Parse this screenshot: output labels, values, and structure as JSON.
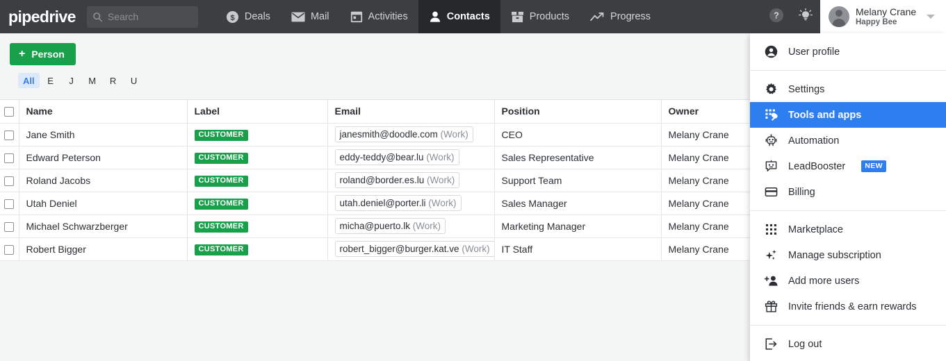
{
  "topnav": {
    "brand": "pipedrive",
    "search": {
      "placeholder": "Search",
      "value": "",
      "icon": "search-icon"
    },
    "items": [
      {
        "label": "Deals",
        "icon": "dollar-circle-icon",
        "active": false
      },
      {
        "label": "Mail",
        "icon": "envelope-icon",
        "active": false
      },
      {
        "label": "Activities",
        "icon": "calendar-icon",
        "active": false
      },
      {
        "label": "Contacts",
        "icon": "person-icon",
        "active": true
      },
      {
        "label": "Products",
        "icon": "box-icon",
        "active": false
      },
      {
        "label": "Progress",
        "icon": "trend-up-icon",
        "active": false
      }
    ],
    "help_icon": "question-circle-icon",
    "tips_icon": "lightbulb-icon",
    "user": {
      "name": "Melany Crane",
      "company": "Happy Bee",
      "avatar": "avatar",
      "caret": "chevron-down-icon"
    }
  },
  "toolbar": {
    "add_person_label": "Person",
    "add_person_plus": "+",
    "alpha_tabs": [
      {
        "label": "All",
        "active": true
      },
      {
        "label": "E",
        "active": false
      },
      {
        "label": "J",
        "active": false
      },
      {
        "label": "M",
        "active": false
      },
      {
        "label": "R",
        "active": false
      },
      {
        "label": "U",
        "active": false
      }
    ]
  },
  "table": {
    "columns": [
      "Name",
      "Label",
      "Email",
      "Position",
      "Owner"
    ],
    "rows": [
      {
        "name": "Jane Smith",
        "label": "CUSTOMER",
        "email": "janesmith@doodle.com",
        "email_type": "(Work)",
        "position": "CEO",
        "owner": "Melany Crane"
      },
      {
        "name": "Edward Peterson",
        "label": "CUSTOMER",
        "email": "eddy-teddy@bear.lu",
        "email_type": "(Work)",
        "position": "Sales Representative",
        "owner": "Melany Crane"
      },
      {
        "name": "Roland Jacobs",
        "label": "CUSTOMER",
        "email": "roland@border.es.lu",
        "email_type": "(Work)",
        "position": "Support Team",
        "owner": "Melany Crane"
      },
      {
        "name": "Utah Deniel",
        "label": "CUSTOMER",
        "email": "utah.deniel@porter.li",
        "email_type": "(Work)",
        "position": "Sales Manager",
        "owner": "Melany Crane"
      },
      {
        "name": "Michael Schwarzberger",
        "label": "CUSTOMER",
        "email": "micha@puerto.lk",
        "email_type": "(Work)",
        "position": "Marketing Manager",
        "owner": "Melany Crane"
      },
      {
        "name": "Robert Bigger",
        "label": "CUSTOMER",
        "email": "robert_bigger@burger.kat.ve",
        "email_type": "(Work)",
        "position": "IT Staff",
        "owner": "Melany Crane"
      }
    ]
  },
  "dropdown": {
    "groups": [
      [
        {
          "label": "User profile",
          "icon": "user-circle-icon",
          "selected": false,
          "badge": ""
        }
      ],
      [
        {
          "label": "Settings",
          "icon": "gear-icon",
          "selected": false,
          "badge": ""
        },
        {
          "label": "Tools and apps",
          "icon": "tools-apps-icon",
          "selected": true,
          "badge": ""
        },
        {
          "label": "Automation",
          "icon": "robot-icon",
          "selected": false,
          "badge": ""
        },
        {
          "label": "LeadBooster",
          "icon": "chatbot-icon",
          "selected": false,
          "badge": "NEW"
        },
        {
          "label": "Billing",
          "icon": "credit-card-icon",
          "selected": false,
          "badge": ""
        }
      ],
      [
        {
          "label": "Marketplace",
          "icon": "grid-dots-icon",
          "selected": false,
          "badge": ""
        },
        {
          "label": "Manage subscription",
          "icon": "sparkles-icon",
          "selected": false,
          "badge": ""
        },
        {
          "label": "Add more users",
          "icon": "user-plus-icon",
          "selected": false,
          "badge": ""
        },
        {
          "label": "Invite friends & earn rewards",
          "icon": "gift-icon",
          "selected": false,
          "badge": ""
        }
      ],
      [
        {
          "label": "Log out",
          "icon": "logout-icon",
          "selected": false,
          "badge": ""
        }
      ]
    ]
  },
  "colors": {
    "nav_bg": "#3b3f42",
    "nav_active_bg": "#26292b",
    "accent_green": "#18a04a",
    "accent_blue": "#2d7ff0",
    "tab_active_bg": "#dbe9fb",
    "page_bg": "#f4f5f5"
  }
}
